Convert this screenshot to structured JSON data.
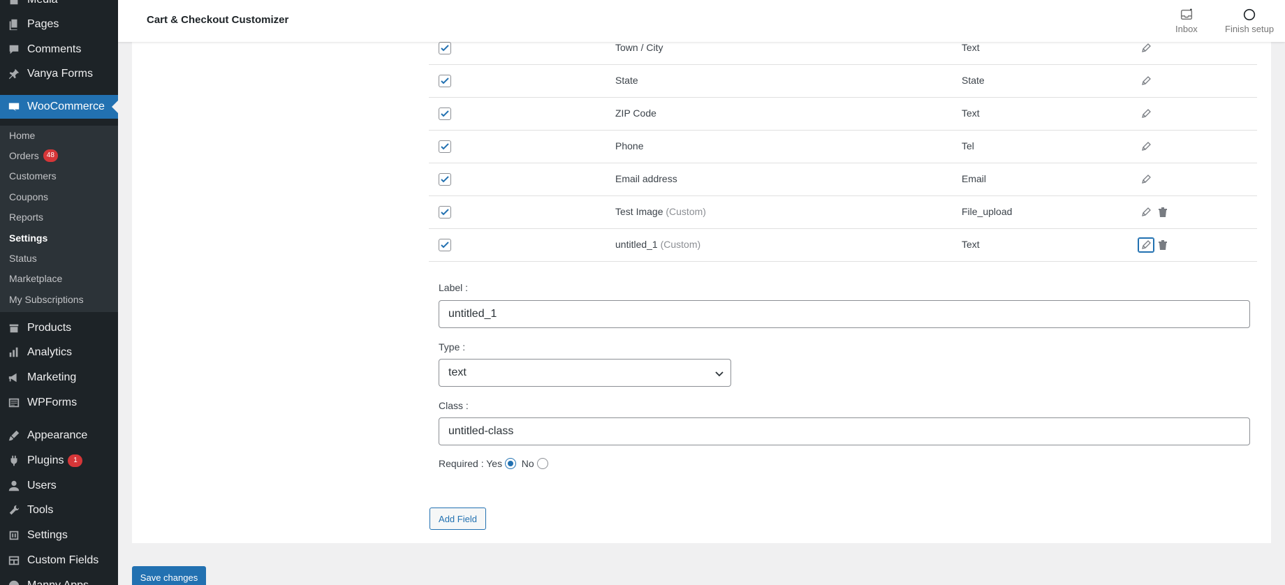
{
  "header": {
    "title": "Cart & Checkout Customizer",
    "inbox_label": "Inbox",
    "finish_setup_label": "Finish setup"
  },
  "sidebar": {
    "items": [
      {
        "label": "Media",
        "icon": "media-icon"
      },
      {
        "label": "Pages",
        "icon": "pages-icon"
      },
      {
        "label": "Comments",
        "icon": "comments-icon"
      },
      {
        "label": "Vanya Forms",
        "icon": "pin-icon"
      },
      {
        "label": "WooCommerce",
        "icon": "woo-icon"
      },
      {
        "label": "Products",
        "icon": "products-icon"
      },
      {
        "label": "Analytics",
        "icon": "analytics-icon"
      },
      {
        "label": "Marketing",
        "icon": "marketing-icon"
      },
      {
        "label": "WPForms",
        "icon": "wpforms-icon"
      },
      {
        "label": "Appearance",
        "icon": "appearance-icon"
      },
      {
        "label": "Plugins",
        "icon": "plugins-icon",
        "badge": "1"
      },
      {
        "label": "Users",
        "icon": "users-icon"
      },
      {
        "label": "Tools",
        "icon": "tools-icon"
      },
      {
        "label": "Settings",
        "icon": "settings-icon"
      },
      {
        "label": "Custom Fields",
        "icon": "custom-fields-icon"
      },
      {
        "label": "Manny Apps",
        "icon": "apps-icon"
      }
    ],
    "submenu": [
      {
        "label": "Home"
      },
      {
        "label": "Orders",
        "badge": "48"
      },
      {
        "label": "Customers"
      },
      {
        "label": "Coupons"
      },
      {
        "label": "Reports"
      },
      {
        "label": "Settings",
        "current": true
      },
      {
        "label": "Status"
      },
      {
        "label": "Marketplace"
      },
      {
        "label": "My Subscriptions"
      }
    ]
  },
  "fields_table": {
    "rows": [
      {
        "label": "Town / City",
        "custom": "",
        "type": "Text",
        "deletable": false
      },
      {
        "label": "State",
        "custom": "",
        "type": "State",
        "deletable": false
      },
      {
        "label": "ZIP Code",
        "custom": "",
        "type": "Text",
        "deletable": false
      },
      {
        "label": "Phone",
        "custom": "",
        "type": "Tel",
        "deletable": false
      },
      {
        "label": "Email address",
        "custom": "",
        "type": "Email",
        "deletable": false
      },
      {
        "label": "Test Image",
        "custom": "(Custom)",
        "type": "File_upload",
        "deletable": true
      },
      {
        "label": "untitled_1",
        "custom": "(Custom)",
        "type": "Text",
        "deletable": true
      }
    ]
  },
  "edit_form": {
    "label_caption": "Label :",
    "label_value": "untitled_1",
    "type_caption": "Type :",
    "type_value": "text",
    "class_caption": "Class :",
    "class_value": "untitled-class",
    "required_caption": "Required :",
    "yes_label": "Yes",
    "no_label": "No",
    "required_selected": "Yes"
  },
  "buttons": {
    "add_field": "Add Field",
    "save_changes": "Save changes"
  },
  "colors": {
    "accent": "#2271b1",
    "sidebar_bg": "#1d2327",
    "badge": "#d63638"
  }
}
